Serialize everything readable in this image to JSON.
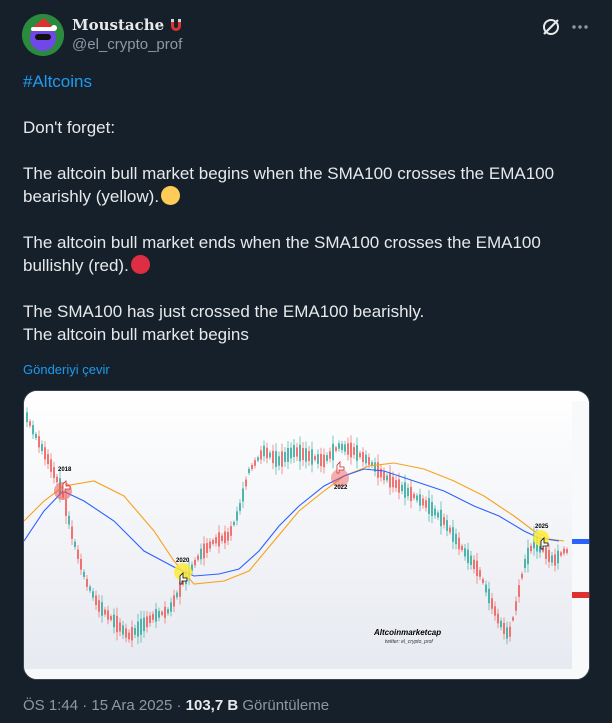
{
  "author": {
    "display_name": "Moustache",
    "handle": "@el_crypto_prof"
  },
  "tweet": {
    "hashtag": "#Altcoins",
    "line1": "Don't forget:",
    "line2": "The altcoin bull market begins when the SMA100 crosses the EMA100 bearishly (yellow).",
    "line3": "The altcoin bull market ends when the SMA100 crosses the EMA100 bullishly (red).",
    "line4": "The SMA100 has just crossed the EMA100 bearishly.",
    "line5": "The altcoin bull market begins",
    "translate_label": "Gönderiyi çevir"
  },
  "chart": {
    "labels": [
      "2018",
      "2020",
      "2022",
      "2025"
    ],
    "watermark_title": "Altcoinmarketcap",
    "watermark_sub": "twitter: el_crypto_prof",
    "colors": {
      "sma": "#2962ff",
      "ema": "#f7a21b",
      "bull_end": "#ef5350",
      "bull_begin": "#ffeb3b"
    }
  },
  "meta": {
    "time": "ÖS 1:44",
    "date": "15 Ara 2025",
    "views_count": "103,7 B",
    "views_label": "Görüntüleme"
  }
}
